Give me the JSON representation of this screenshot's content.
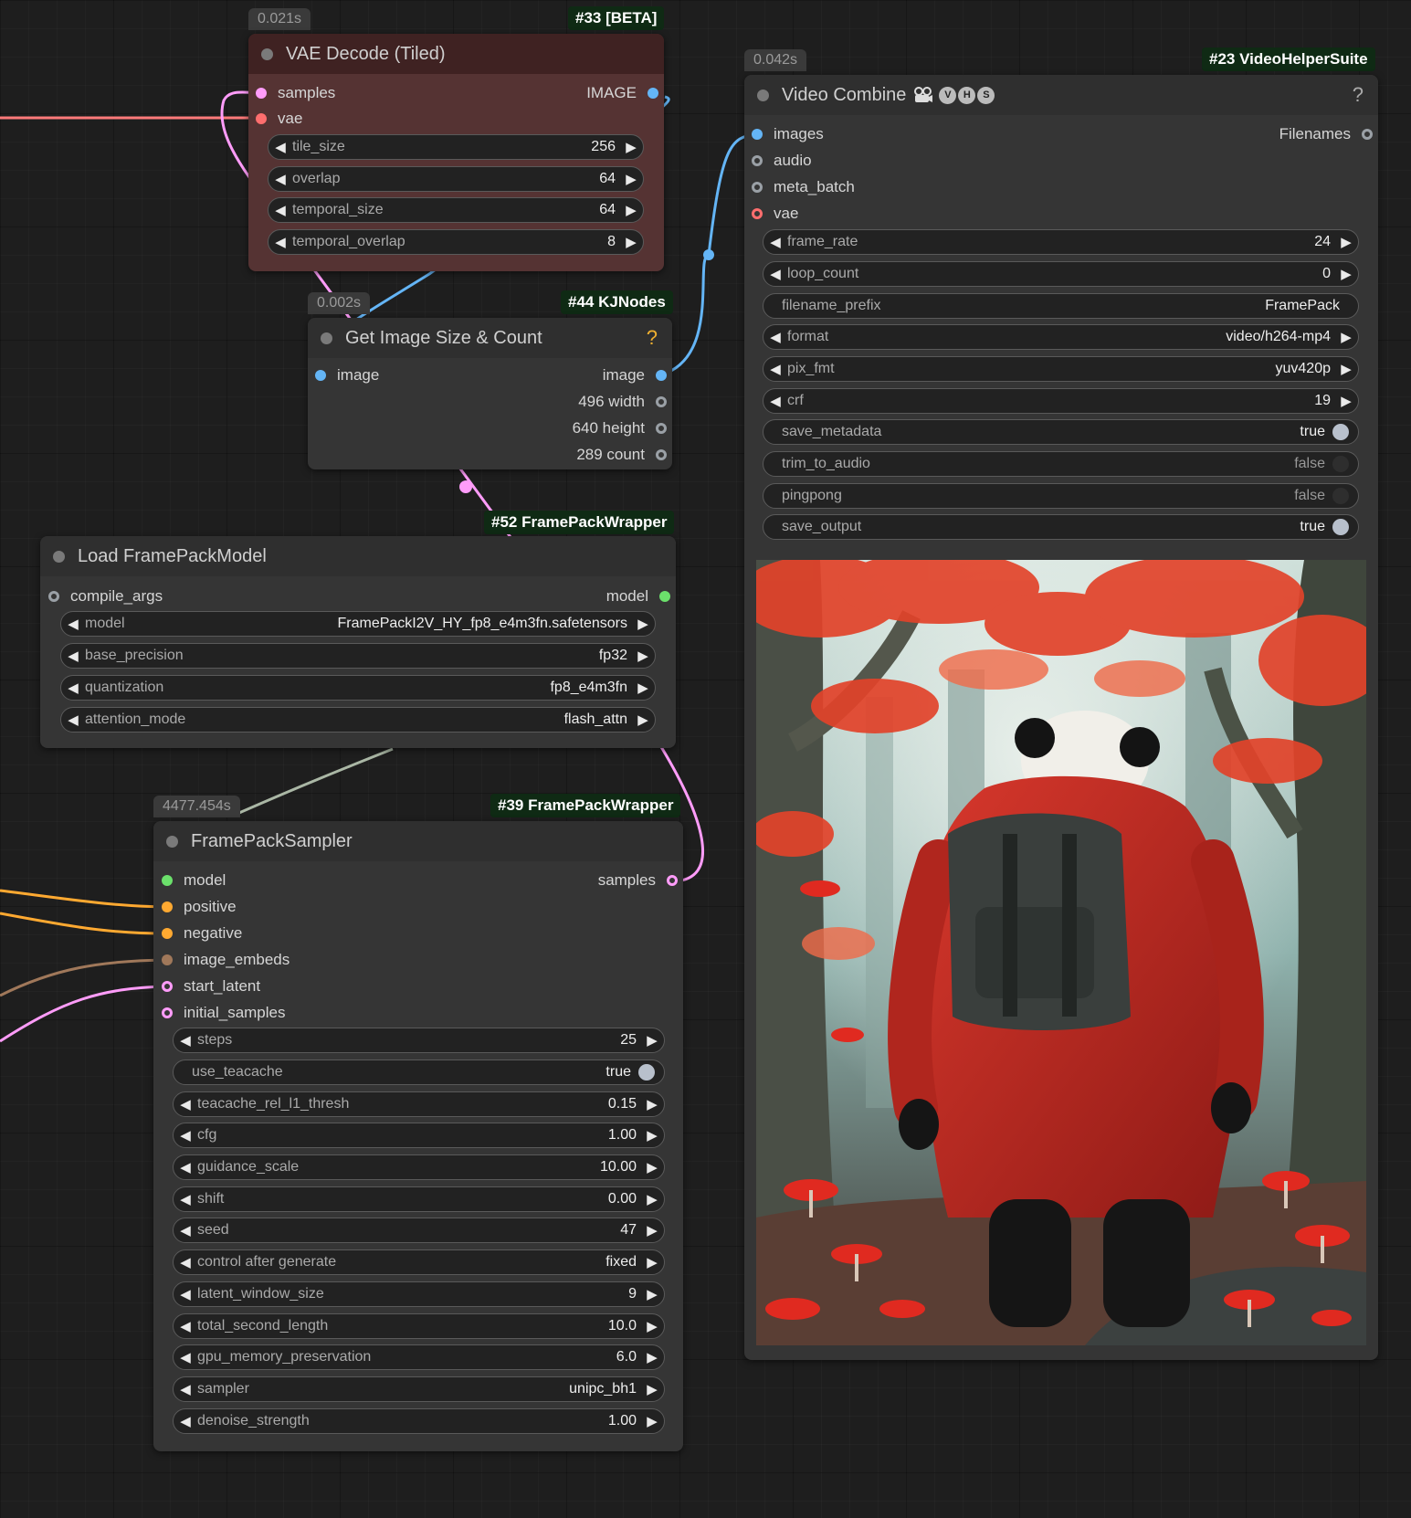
{
  "vae_decode": {
    "time": "0.021s",
    "id": "#33 [BETA]",
    "title": "VAE Decode (Tiled)",
    "inputs": [
      "samples",
      "vae"
    ],
    "output": "IMAGE",
    "widgets": [
      {
        "label": "tile_size",
        "value": "256"
      },
      {
        "label": "overlap",
        "value": "64"
      },
      {
        "label": "temporal_size",
        "value": "64"
      },
      {
        "label": "temporal_overlap",
        "value": "8"
      }
    ]
  },
  "image_size": {
    "time": "0.002s",
    "id": "#44 KJNodes",
    "title": "Get Image Size & Count",
    "help": "?",
    "input": "image",
    "outputs": [
      "image",
      "496 width",
      "640 height",
      "289 count"
    ]
  },
  "load_model": {
    "id": "#52 FramePackWrapper",
    "title": "Load FramePackModel",
    "input": "compile_args",
    "output": "model",
    "widgets": [
      {
        "label": "model",
        "value": "FramePackI2V_HY_fp8_e4m3fn.safetensors"
      },
      {
        "label": "base_precision",
        "value": "fp32"
      },
      {
        "label": "quantization",
        "value": "fp8_e4m3fn"
      },
      {
        "label": "attention_mode",
        "value": "flash_attn"
      }
    ]
  },
  "sampler": {
    "time": "4477.454s",
    "id": "#39 FramePackWrapper",
    "title": "FramePackSampler",
    "inputs": [
      "model",
      "positive",
      "negative",
      "image_embeds",
      "start_latent",
      "initial_samples"
    ],
    "output": "samples",
    "widgets": [
      {
        "label": "steps",
        "value": "25"
      },
      {
        "label": "use_teacache",
        "value": "true"
      },
      {
        "label": "teacache_rel_l1_thresh",
        "value": "0.15"
      },
      {
        "label": "cfg",
        "value": "1.00"
      },
      {
        "label": "guidance_scale",
        "value": "10.00"
      },
      {
        "label": "shift",
        "value": "0.00"
      },
      {
        "label": "seed",
        "value": "47"
      },
      {
        "label": "control after generate",
        "value": "fixed"
      },
      {
        "label": "latent_window_size",
        "value": "9"
      },
      {
        "label": "total_second_length",
        "value": "10.0"
      },
      {
        "label": "gpu_memory_preservation",
        "value": "6.0"
      },
      {
        "label": "sampler",
        "value": "unipc_bh1"
      },
      {
        "label": "denoise_strength",
        "value": "1.00"
      }
    ]
  },
  "video_combine": {
    "time": "0.042s",
    "id": "#23 VideoHelperSuite",
    "title": "Video Combine",
    "badges": [
      "V",
      "H",
      "S"
    ],
    "help": "?",
    "inputs": [
      "images",
      "audio",
      "meta_batch",
      "vae"
    ],
    "output": "Filenames",
    "widgets": [
      {
        "label": "frame_rate",
        "value": "24"
      },
      {
        "label": "loop_count",
        "value": "0"
      },
      {
        "label": "filename_prefix",
        "value": "FramePack"
      },
      {
        "label": "format",
        "value": "video/h264-mp4"
      },
      {
        "label": "pix_fmt",
        "value": "yuv420p"
      },
      {
        "label": "crf",
        "value": "19"
      },
      {
        "label": "save_metadata",
        "value": "true"
      },
      {
        "label": "trim_to_audio",
        "value": "false"
      },
      {
        "label": "pingpong",
        "value": "false"
      },
      {
        "label": "save_output",
        "value": "true"
      }
    ]
  },
  "icons": {
    "arrow_left": "◀",
    "arrow_right": "▶",
    "camera": "camera-icon"
  },
  "colors": {
    "image_port": "#64b5f6",
    "latent_port": "#ff9cf9",
    "vae_port": "#ff6e6e",
    "model_port": "#b39ddb",
    "conditioning_port": "#ffa931",
    "embeds_port": "#a0785a",
    "generic_port": "#9aa0a6",
    "green_port": "#6be06b"
  }
}
